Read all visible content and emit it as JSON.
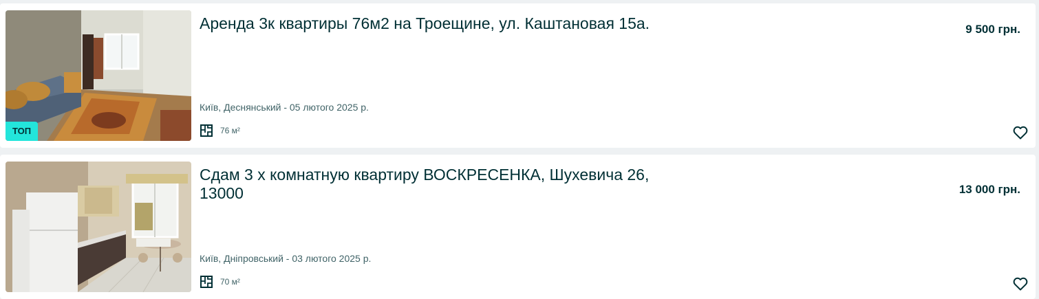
{
  "listings": [
    {
      "title": "Аренда 3к квартиры 76м2 на Троещине, ул. Каштановая 15а.",
      "price": "9 500 грн.",
      "location_date": "Київ, Деснянський - 05 лютого 2025 р.",
      "area": "76 м²",
      "badge": "ТОП",
      "icons": [
        "area-plan-icon",
        "heart-icon"
      ]
    },
    {
      "title": "Сдам 3 х комнатную квартиру ВОСКРЕСЕНКА, Шухевича 26, 13000",
      "price": "13 000 грн.",
      "location_date": "Київ, Дніпровський - 03 лютого 2025 р.",
      "area": "70 м²",
      "icons": [
        "area-plan-icon",
        "heart-icon"
      ]
    }
  ],
  "colors": {
    "background": "#eef1f3",
    "card": "#ffffff",
    "text_primary": "#002f34",
    "text_secondary": "#406367",
    "badge_top": "#23e5db"
  }
}
